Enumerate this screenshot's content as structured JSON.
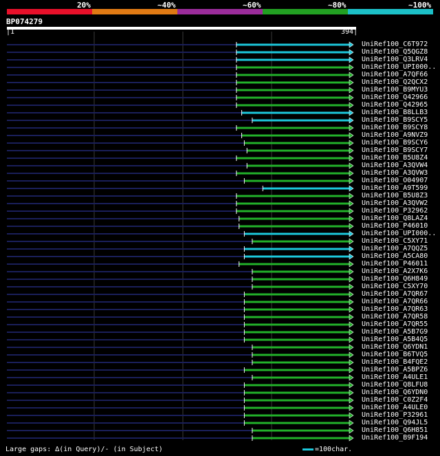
{
  "legend": {
    "labels": [
      "20%",
      "~40%",
      "~60%",
      "~80%",
      "~100%"
    ],
    "colors": [
      "#e8102a",
      "#e07a14",
      "#9b2c9b",
      "#22a022",
      "#1cc0c8"
    ]
  },
  "query": {
    "id": "BP074279",
    "start": "1",
    "end": "394"
  },
  "colors": {
    "identity_high": "#1cc8dc",
    "identity_mid": "#22b22a",
    "unaligned": "#1a1f5a",
    "gridline": "#3a3a3a"
  },
  "hits": [
    {
      "label": "UniRef100_C6T972",
      "start": 261,
      "cls": "c"
    },
    {
      "label": "UniRef100_Q5QGZ8",
      "start": 261,
      "cls": "c"
    },
    {
      "label": "UniRef100_Q3LRV4",
      "start": 261,
      "cls": "c"
    },
    {
      "label": "UniRef100_UPI000..",
      "start": 261,
      "cls": "g"
    },
    {
      "label": "UniRef100_A7QF66",
      "start": 261,
      "cls": "g"
    },
    {
      "label": "UniRef100_Q2QCX2",
      "start": 261,
      "cls": "g"
    },
    {
      "label": "UniRef100_B9MYU3",
      "start": 261,
      "cls": "g"
    },
    {
      "label": "UniRef100_Q42966",
      "start": 261,
      "cls": "g"
    },
    {
      "label": "UniRef100_Q42965",
      "start": 261,
      "cls": "g"
    },
    {
      "label": "UniRef100_B8LLB3",
      "start": 267,
      "cls": "c"
    },
    {
      "label": "UniRef100_B9SCY5",
      "start": 279,
      "cls": "c"
    },
    {
      "label": "UniRef100_B9SCY8",
      "start": 261,
      "cls": "g"
    },
    {
      "label": "UniRef100_A9NVZ9",
      "start": 267,
      "cls": "g"
    },
    {
      "label": "UniRef100_B9SCY6",
      "start": 270,
      "cls": "g"
    },
    {
      "label": "UniRef100_B9SCY7",
      "start": 273,
      "cls": "g"
    },
    {
      "label": "UniRef100_B5U8Z4",
      "start": 261,
      "cls": "g"
    },
    {
      "label": "UniRef100_A3QVW4",
      "start": 273,
      "cls": "g"
    },
    {
      "label": "UniRef100_A3QVW3",
      "start": 261,
      "cls": "g"
    },
    {
      "label": "UniRef100_O04907",
      "start": 270,
      "cls": "g"
    },
    {
      "label": "UniRef100_A9T599",
      "start": 291,
      "cls": "c"
    },
    {
      "label": "UniRef100_B5U8Z3",
      "start": 261,
      "cls": "g"
    },
    {
      "label": "UniRef100_A3QVW2",
      "start": 261,
      "cls": "g"
    },
    {
      "label": "UniRef100_P32962",
      "start": 261,
      "cls": "g"
    },
    {
      "label": "UniRef100_Q8LAZ4",
      "start": 264,
      "cls": "g"
    },
    {
      "label": "UniRef100_P46010",
      "start": 264,
      "cls": "g"
    },
    {
      "label": "UniRef100_UPI000..",
      "start": 270,
      "cls": "c"
    },
    {
      "label": "UniRef100_C5XY71",
      "start": 279,
      "cls": "g"
    },
    {
      "label": "UniRef100_A7QQZ5",
      "start": 270,
      "cls": "c"
    },
    {
      "label": "UniRef100_A5CA80",
      "start": 270,
      "cls": "c"
    },
    {
      "label": "UniRef100_P46011",
      "start": 264,
      "cls": "g"
    },
    {
      "label": "UniRef100_A2X7K6",
      "start": 279,
      "cls": "g"
    },
    {
      "label": "UniRef100_Q6H849",
      "start": 279,
      "cls": "g"
    },
    {
      "label": "UniRef100_C5XY70",
      "start": 279,
      "cls": "g"
    },
    {
      "label": "UniRef100_A7QR67",
      "start": 270,
      "cls": "g"
    },
    {
      "label": "UniRef100_A7QR66",
      "start": 270,
      "cls": "g"
    },
    {
      "label": "UniRef100_A7QR63",
      "start": 270,
      "cls": "g"
    },
    {
      "label": "UniRef100_A7QR58",
      "start": 270,
      "cls": "g"
    },
    {
      "label": "UniRef100_A7QR55",
      "start": 270,
      "cls": "g"
    },
    {
      "label": "UniRef100_A5B7G9",
      "start": 270,
      "cls": "g"
    },
    {
      "label": "UniRef100_A5B4Q5",
      "start": 270,
      "cls": "g"
    },
    {
      "label": "UniRef100_Q6YDN1",
      "start": 279,
      "cls": "g"
    },
    {
      "label": "UniRef100_B6TVQ5",
      "start": 279,
      "cls": "g"
    },
    {
      "label": "UniRef100_B4FQE2",
      "start": 279,
      "cls": "g"
    },
    {
      "label": "UniRef100_A5BPZ6",
      "start": 270,
      "cls": "g"
    },
    {
      "label": "UniRef100_A4ULE1",
      "start": 279,
      "cls": "g"
    },
    {
      "label": "UniRef100_Q8LFU8",
      "start": 270,
      "cls": "g"
    },
    {
      "label": "UniRef100_Q6YDN0",
      "start": 270,
      "cls": "g"
    },
    {
      "label": "UniRef100_C0Z2F4",
      "start": 270,
      "cls": "g"
    },
    {
      "label": "UniRef100_A4ULE0",
      "start": 270,
      "cls": "g"
    },
    {
      "label": "UniRef100_P32961",
      "start": 270,
      "cls": "g"
    },
    {
      "label": "UniRef100_Q94JL5",
      "start": 270,
      "cls": "g"
    },
    {
      "label": "UniRef100_Q6H851",
      "start": 279,
      "cls": "g"
    },
    {
      "label": "UniRef100_B9F194",
      "start": 279,
      "cls": "g"
    }
  ],
  "footer": "Large gaps: ∆(in Query)/- (in Subject)",
  "key": "=100char."
}
